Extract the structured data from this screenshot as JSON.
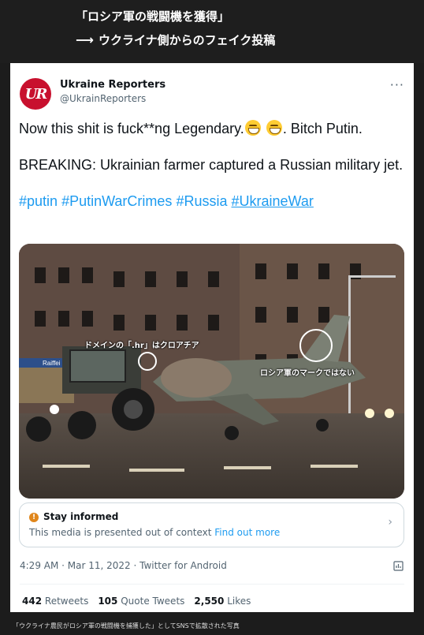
{
  "banner": {
    "line1": "「ロシア軍の戦闘機を獲得」",
    "arrow": "⟶",
    "line2": "ウクライナ側からのフェイク投稿"
  },
  "tweet": {
    "avatar_text": "UR",
    "display_name": "Ukraine Reporters",
    "handle": "@UkrainReporters",
    "more_icon": "more-icon",
    "line1_before_emoji": "Now this shit is fuck**ng Legendary.",
    "line1_after_emoji": ". Bitch Putin.",
    "line2": "BREAKING: Ukrainian farmer captured a Russian military jet.",
    "hashtags": [
      "#putin",
      "#PutinWarCrimes",
      "#Russia",
      "#UkraineWar"
    ],
    "timestamp": "4:29 AM · Mar 11, 2022 · Twitter for Android",
    "stats": {
      "retweets_count": "442",
      "retweets_label": "Retweets",
      "quotes_count": "105",
      "quotes_label": "Quote Tweets",
      "likes_count": "2,550",
      "likes_label": "Likes"
    }
  },
  "media": {
    "annotation_domain": "ドメインの「.hr」はクロアチア",
    "annotation_mark": "ロシア軍のマークではない",
    "shop_sign": "Raiffei"
  },
  "notice": {
    "title": "Stay informed",
    "body": "This media is presented out of context",
    "link": "Find out more"
  },
  "caption": "「ウクライナ農民がロシア軍の戦闘機を捕獲した」としてSNSで拡散された写真",
  "colors": {
    "link": "#1d9bf0",
    "avatar": "#c8102e",
    "notice_icon": "#e0861b"
  }
}
